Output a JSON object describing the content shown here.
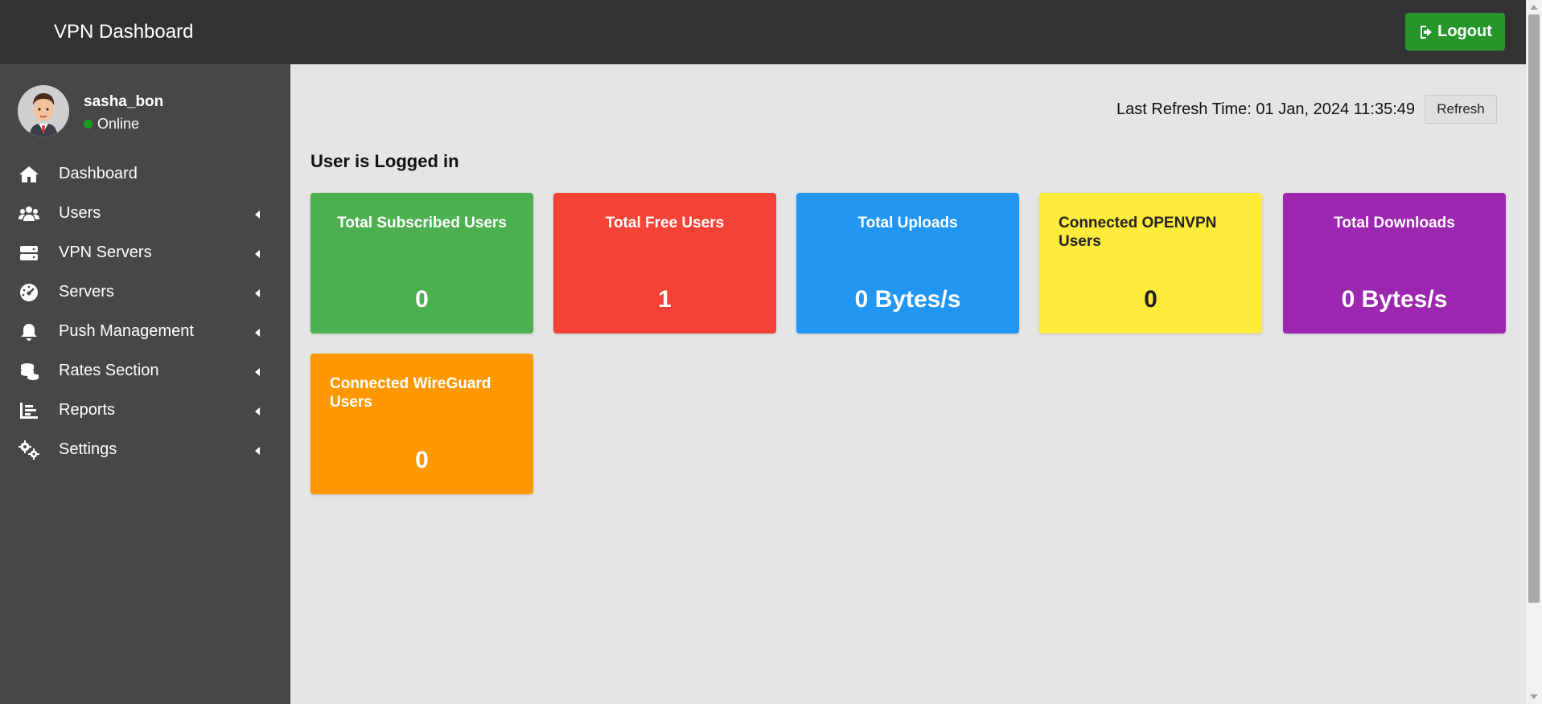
{
  "header": {
    "title": "VPN Dashboard",
    "logout_label": "Logout"
  },
  "user": {
    "name": "sasha_bon",
    "status": "Online"
  },
  "sidebar": {
    "items": [
      {
        "label": "Dashboard",
        "icon": "home-icon"
      },
      {
        "label": "Users",
        "icon": "users-icon"
      },
      {
        "label": "VPN Servers",
        "icon": "server-icon"
      },
      {
        "label": "Servers",
        "icon": "gauge-icon"
      },
      {
        "label": "Push Management",
        "icon": "bell-icon"
      },
      {
        "label": "Rates Section",
        "icon": "coins-icon"
      },
      {
        "label": "Reports",
        "icon": "chart-icon"
      },
      {
        "label": "Settings",
        "icon": "cogs-icon"
      }
    ]
  },
  "main": {
    "refresh_text": "Last Refresh Time: 01 Jan, 2024 11:35:49",
    "refresh_label": "Refresh",
    "heading": "User is Logged in",
    "cards": [
      {
        "title": "Total Subscribed Users",
        "value": "0",
        "color": "#4caf50",
        "text_color": "#ffffff"
      },
      {
        "title": "Total Free Users",
        "value": "1",
        "color": "#f44336",
        "text_color": "#ffffff"
      },
      {
        "title": "Total Uploads",
        "value": "0 Bytes/s",
        "color": "#2196f3",
        "text_color": "#ffffff"
      },
      {
        "title": "Connected OPENVPN Users",
        "value": "0",
        "color": "#ffeb3b",
        "text_color": "#222222"
      },
      {
        "title": "Total Downloads",
        "value": "0 Bytes/s",
        "color": "#9c27b0",
        "text_color": "#ffffff"
      },
      {
        "title": "Connected WireGuard Users",
        "value": "0",
        "color": "#ff9800",
        "text_color": "#ffffff"
      }
    ]
  }
}
